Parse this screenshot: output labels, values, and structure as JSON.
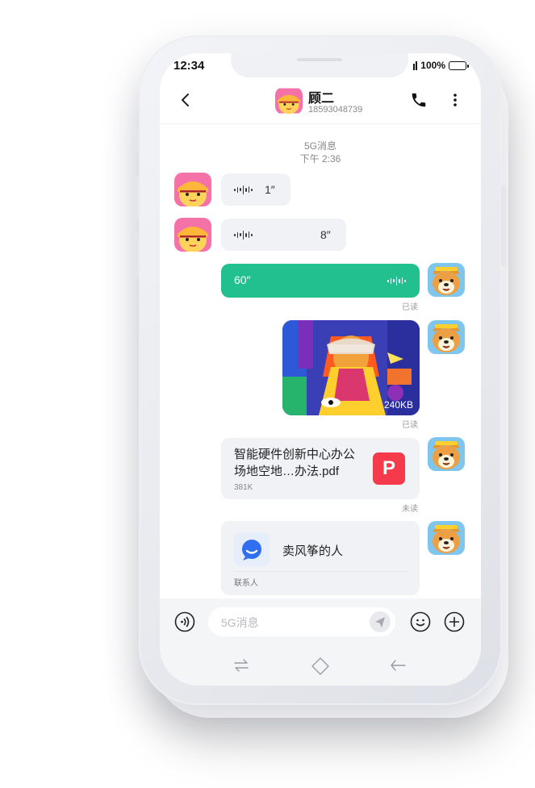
{
  "status_bar": {
    "time": "12:34",
    "battery": "100%"
  },
  "header": {
    "contact_name": "顾二",
    "contact_phone": "18593048739"
  },
  "chat": {
    "system_label": "5G消息",
    "timestamp": "下午 2:36",
    "messages": [
      {
        "kind": "voice",
        "direction": "incoming",
        "duration": "1″"
      },
      {
        "kind": "voice",
        "direction": "incoming",
        "duration": "8″"
      },
      {
        "kind": "voice",
        "direction": "outgoing",
        "duration": "60″",
        "status": "已读"
      },
      {
        "kind": "image",
        "direction": "outgoing",
        "size": "240KB",
        "status": "已读"
      },
      {
        "kind": "file",
        "direction": "outgoing",
        "title_line1": "智能硬件创新中心办公",
        "title_line2": "场地空地…办法.pdf",
        "size": "381K",
        "file_type": "P",
        "status": "未读"
      },
      {
        "kind": "contact",
        "direction": "outgoing",
        "name": "卖风筝的人",
        "type_label": "联系人"
      }
    ]
  },
  "composer": {
    "placeholder": "5G消息"
  },
  "colors": {
    "accent_green": "#22c08f",
    "pdf_red": "#f53a4b",
    "contact_blue": "#2f6ff0"
  },
  "icons": [
    "back-icon",
    "phone-icon",
    "more-icon",
    "voice-mode-icon",
    "send-icon",
    "emoji-icon",
    "plus-icon",
    "recent-apps-icon",
    "home-icon",
    "back-nav-icon"
  ]
}
